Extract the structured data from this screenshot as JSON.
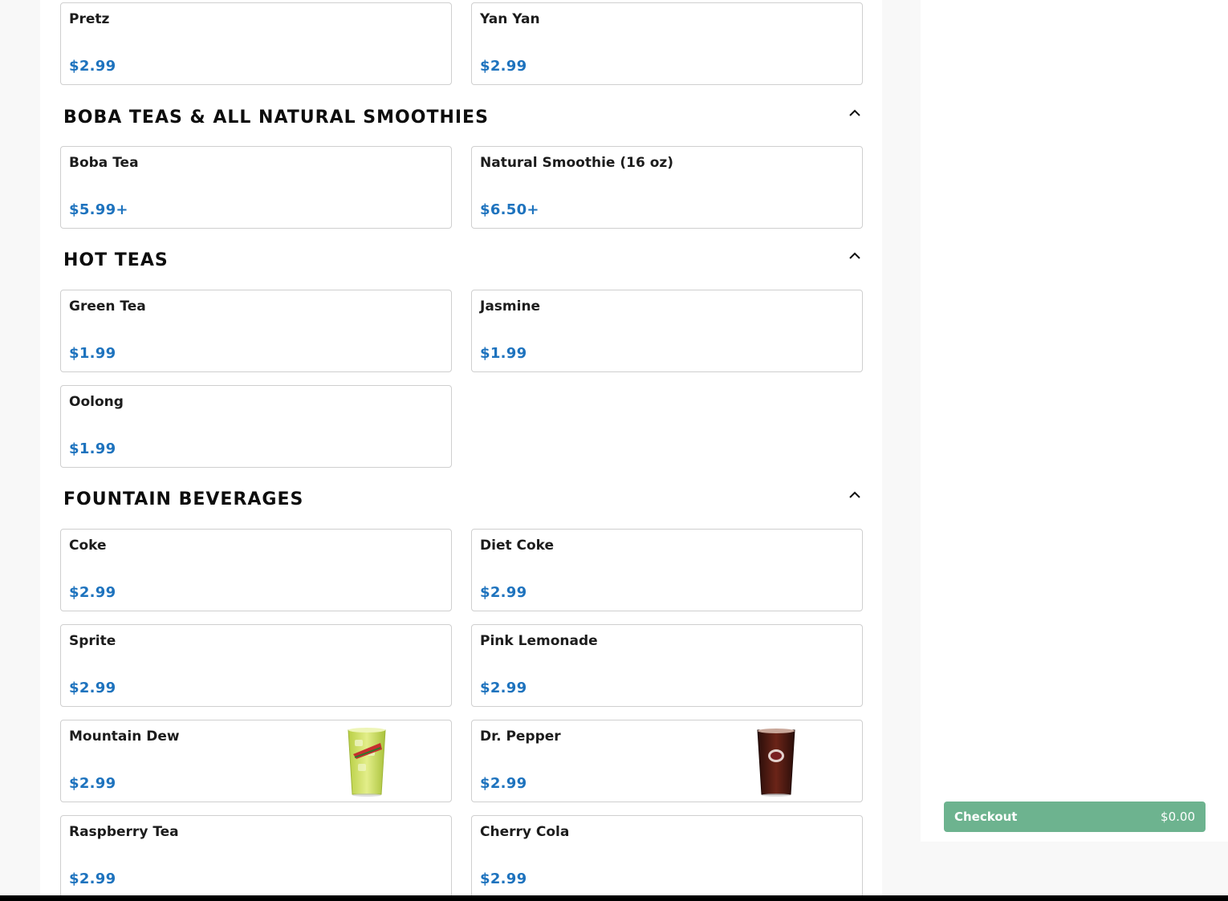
{
  "sections": {
    "snacks": {
      "items": [
        {
          "name": "Pretz",
          "price": "$2.99"
        },
        {
          "name": "Yan Yan",
          "price": "$2.99"
        }
      ]
    },
    "boba": {
      "title": "BOBA TEAS & ALL NATURAL SMOOTHIES",
      "items": [
        {
          "name": "Boba Tea",
          "price": "$5.99+"
        },
        {
          "name": "Natural Smoothie (16 oz)",
          "price": "$6.50+"
        }
      ]
    },
    "hot_teas": {
      "title": "HOT TEAS",
      "items": [
        {
          "name": "Green Tea",
          "price": "$1.99"
        },
        {
          "name": "Jasmine",
          "price": "$1.99"
        },
        {
          "name": "Oolong",
          "price": "$1.99"
        }
      ]
    },
    "fountain": {
      "title": "FOUNTAIN BEVERAGES",
      "items": [
        {
          "name": "Coke",
          "price": "$2.99"
        },
        {
          "name": "Diet Coke",
          "price": "$2.99"
        },
        {
          "name": "Sprite",
          "price": "$2.99"
        },
        {
          "name": "Pink Lemonade",
          "price": "$2.99"
        },
        {
          "name": "Mountain Dew",
          "price": "$2.99"
        },
        {
          "name": "Dr. Pepper",
          "price": "$2.99"
        },
        {
          "name": "Raspberry Tea",
          "price": "$2.99"
        },
        {
          "name": "Cherry Cola",
          "price": "$2.99"
        }
      ]
    }
  },
  "cart": {
    "checkout_label": "Checkout",
    "total": "$0.00"
  },
  "icons": {
    "section_toggle": "chevron-up-icon"
  },
  "colors": {
    "price": "#1e73be",
    "checkout": "#6db38f"
  }
}
